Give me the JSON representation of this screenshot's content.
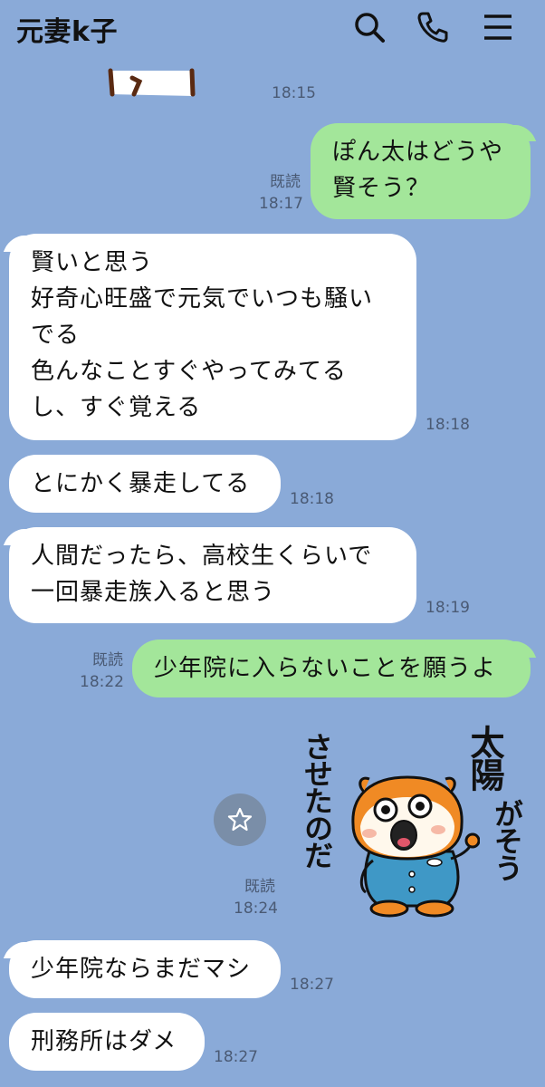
{
  "header": {
    "title": "元妻k子",
    "icons": [
      "search-icon",
      "phone-icon",
      "menu-icon"
    ]
  },
  "messages": [
    {
      "time": "18:15"
    },
    {
      "read": "既読",
      "time": "18:17",
      "text": "ぽん太はどうや\n賢そう？"
    },
    {
      "time": "18:18",
      "text": "賢いと思う\n好奇心旺盛で元気でいつも騒い\nでる\n色んなことすぐやってみてる\nし、すぐ覚える"
    },
    {
      "time": "18:18",
      "text": "とにかく暴走してる"
    },
    {
      "time": "18:19",
      "text": "人間だったら、高校生くらいで\n一回暴走族入ると思う"
    },
    {
      "read": "既読",
      "time": "18:22",
      "text": "少年院に入らないことを願うよ"
    },
    {
      "read": "既読",
      "time": "18:24",
      "sticker_text_left": "させたのだ",
      "sticker_text_right1": "太陽",
      "sticker_text_right2": "がそう"
    },
    {
      "time": "18:27",
      "text": "少年院ならまだマシ"
    },
    {
      "time": "18:27",
      "text": "刑務所はダメ"
    }
  ],
  "colors": {
    "background": "#8aaad8",
    "incoming_bubble": "#ffffff",
    "outgoing_bubble": "#a3e69a",
    "sticker_character": "#f08a24"
  }
}
